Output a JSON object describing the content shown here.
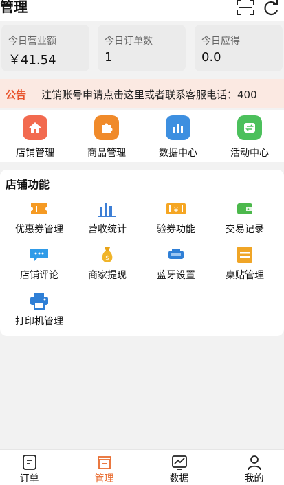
{
  "header": {
    "title": "管理",
    "scan_icon": "scan-icon",
    "refresh_icon": "refresh-icon"
  },
  "stats": [
    {
      "label": "今日营业额",
      "value": "￥41.54"
    },
    {
      "label": "今日订单数",
      "value": "1"
    },
    {
      "label": "今日应得",
      "value": "0.0"
    }
  ],
  "notice": {
    "tag": "公告",
    "text": "注销账号申请点击这里或者联系客服电话：400"
  },
  "quick_actions": [
    {
      "label": "店铺管理",
      "icon": "store-home-icon",
      "color": "#f26a4f"
    },
    {
      "label": "商品管理",
      "icon": "puzzle-icon",
      "color": "#f08a2a"
    },
    {
      "label": "数据中心",
      "icon": "bar-chart-icon",
      "color": "#3d8fe0"
    },
    {
      "label": "活动中心",
      "icon": "swap-icon",
      "color": "#4cc05c"
    }
  ],
  "store_functions": {
    "title": "店铺功能",
    "items": [
      {
        "label": "优惠券管理",
        "icon": "coupon-icon"
      },
      {
        "label": "营收统计",
        "icon": "bar-stats-icon"
      },
      {
        "label": "验券功能",
        "icon": "voucher-yen-icon"
      },
      {
        "label": "交易记录",
        "icon": "wallet-icon"
      },
      {
        "label": "店铺评论",
        "icon": "comment-icon"
      },
      {
        "label": "商家提现",
        "icon": "money-bag-icon"
      },
      {
        "label": "蓝牙设置",
        "icon": "bluetooth-device-icon"
      },
      {
        "label": "桌贴管理",
        "icon": "table-sticker-icon"
      },
      {
        "label": "打印机管理",
        "icon": "printer-icon"
      }
    ]
  },
  "tabbar": {
    "items": [
      {
        "label": "订单",
        "icon": "order-icon"
      },
      {
        "label": "管理",
        "icon": "manage-icon"
      },
      {
        "label": "数据",
        "icon": "data-icon"
      },
      {
        "label": "我的",
        "icon": "profile-icon"
      }
    ],
    "active_color": "#e8692c"
  }
}
